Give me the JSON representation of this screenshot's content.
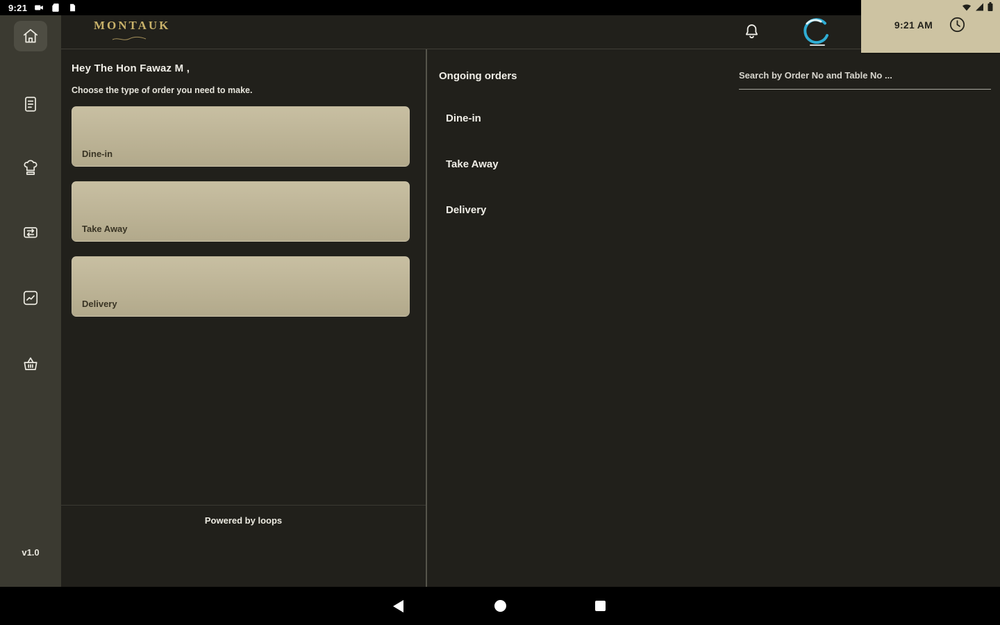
{
  "status_bar": {
    "time": "9:21"
  },
  "clock_panel": {
    "time": "9:21 AM"
  },
  "header": {
    "brand": "MONTAUK"
  },
  "sidebar": {
    "version": "v1.0",
    "items": [
      {
        "name": "home",
        "active": true
      },
      {
        "name": "bills",
        "active": false
      },
      {
        "name": "kitchen",
        "active": false
      },
      {
        "name": "orders",
        "active": false
      },
      {
        "name": "reports",
        "active": false
      },
      {
        "name": "basket",
        "active": false
      }
    ]
  },
  "left_panel": {
    "greeting": "Hey The Hon Fawaz M ,",
    "subtitle": "Choose the type of order you need to make.",
    "order_buttons": [
      {
        "label": "Dine-in"
      },
      {
        "label": "Take Away"
      },
      {
        "label": "Delivery"
      }
    ],
    "footer": "Powered by loops"
  },
  "right_panel": {
    "title": "Ongoing orders",
    "search_placeholder": "Search by Order No and Table No ...",
    "sections": [
      {
        "label": "Dine-in"
      },
      {
        "label": "Take Away"
      },
      {
        "label": "Delivery"
      }
    ]
  },
  "colors": {
    "tan": "#cdc3a2",
    "gold": "#c9b26a",
    "sidebar-bg": "#3b3a31",
    "panel-bg": "#21201b",
    "btn-top": "#c8bfa2",
    "btn-bottom": "#b2a98b",
    "accent-teal": "#2fadd4"
  }
}
